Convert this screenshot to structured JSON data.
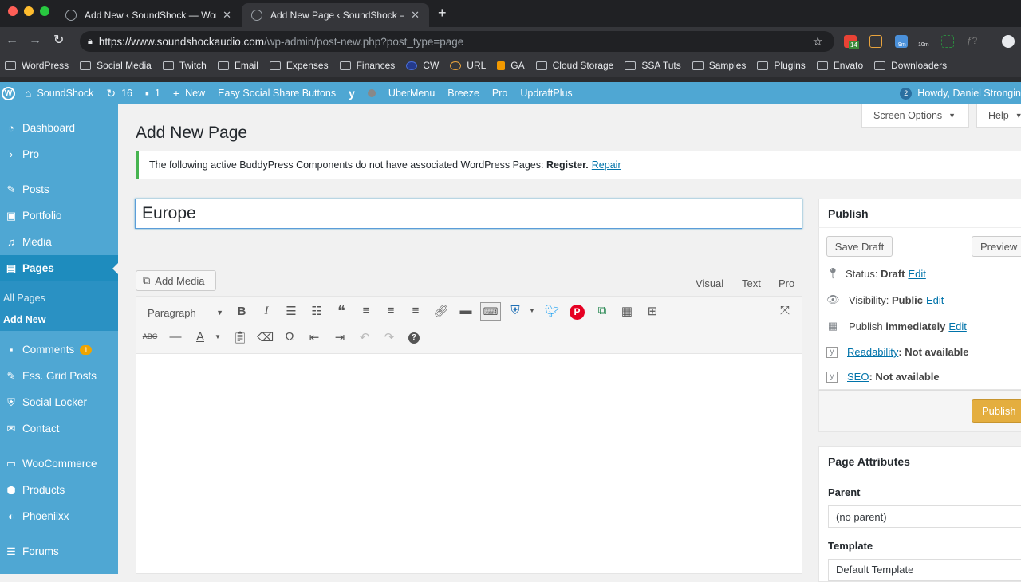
{
  "browser": {
    "tabs": [
      {
        "title": "Add New ‹ SoundShock — Wor"
      },
      {
        "title": "Add New Page ‹ SoundShock — "
      }
    ],
    "new_tab_symbol": "+",
    "url_host": "https://www.soundshockaudio.com",
    "url_path": "/wp-admin/post-new.php?post_type=page",
    "extensions": [
      {
        "color": "#e84235",
        "badge": "14"
      },
      {
        "color": "#e8a33d",
        "badge": ""
      },
      {
        "color": "#4a90d9",
        "badge": "9m"
      },
      {
        "color": "#c8b400",
        "badge": "10m"
      }
    ],
    "bookmarks": [
      "WordPress",
      "Social Media",
      "Twitch",
      "Email",
      "Expenses",
      "Finances",
      "CW",
      "URL",
      "GA",
      "Cloud Storage",
      "SSA Tuts",
      "Samples",
      "Plugins",
      "Envato",
      "Downloaders"
    ]
  },
  "adminbar": {
    "site": "SoundShock",
    "updates": "16",
    "comments": "1",
    "new": "New",
    "items": [
      "Easy Social Share Buttons",
      "UberMenu",
      "Breeze",
      "Pro",
      "UpdraftPlus"
    ],
    "notif": "2",
    "howdy": "Howdy, Daniel Strongin"
  },
  "sidebar": {
    "items": [
      {
        "label": "Dashboard",
        "icon": "dashboard-icon"
      },
      {
        "label": "Pro",
        "icon": "chevron-right-icon"
      },
      {
        "label": "Posts",
        "icon": "pin-icon"
      },
      {
        "label": "Portfolio",
        "icon": "portfolio-icon"
      },
      {
        "label": "Media",
        "icon": "media-icon"
      },
      {
        "label": "Pages",
        "icon": "pages-icon"
      },
      {
        "label": "Comments",
        "icon": "comment-icon",
        "badge": "1"
      },
      {
        "label": "Ess. Grid Posts",
        "icon": "pin-icon"
      },
      {
        "label": "Social Locker",
        "icon": "shield-icon"
      },
      {
        "label": "Contact",
        "icon": "mail-icon"
      },
      {
        "label": "WooCommerce",
        "icon": "woo-icon"
      },
      {
        "label": "Products",
        "icon": "products-icon"
      },
      {
        "label": "Phoeniixx",
        "icon": "phoeniixx-icon"
      },
      {
        "label": "Forums",
        "icon": "forums-icon"
      }
    ],
    "sub_all": "All Pages",
    "sub_add": "Add New"
  },
  "page": {
    "heading": "Add New Page",
    "screen_options": "Screen Options",
    "help": "Help",
    "notice_text": "The following active BuddyPress Components do not have associated WordPress Pages:",
    "notice_strong": "Register.",
    "notice_link": "Repair",
    "title_value": "Europe"
  },
  "editor": {
    "add_media": "Add Media",
    "tabs": [
      "Visual",
      "Text",
      "Pro"
    ],
    "format": "Paragraph"
  },
  "publish_box": {
    "heading": "Publish",
    "save_draft": "Save Draft",
    "preview": "Preview",
    "status_label": "Status:",
    "status_value": "Draft",
    "visibility_label": "Visibility:",
    "visibility_value": "Public",
    "publish_label": "Publish",
    "publish_value": "immediately",
    "edit": "Edit",
    "readability_link": "Readability",
    "readability_value": ": Not available",
    "seo_link": "SEO",
    "seo_value": ": Not available",
    "publish_button": "Publish"
  },
  "attributes_box": {
    "heading": "Page Attributes",
    "parent_label": "Parent",
    "parent_value": "(no parent)",
    "template_label": "Template",
    "template_value": "Default Template"
  }
}
